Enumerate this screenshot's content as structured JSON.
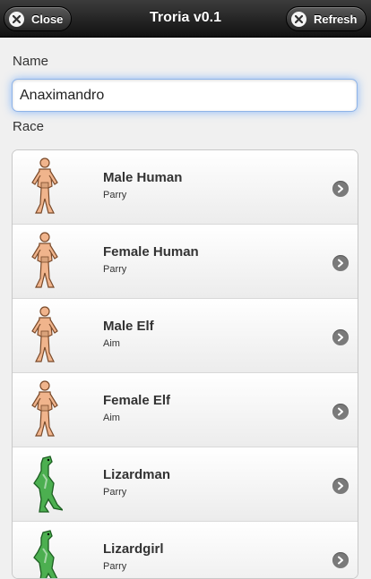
{
  "header": {
    "title": "Troria v0.1",
    "close_label": "Close",
    "refresh_label": "Refresh"
  },
  "form": {
    "name_label": "Name",
    "name_value": "Anaximandro",
    "race_label": "Race"
  },
  "races": [
    {
      "name": "Male Human",
      "skill": "Parry",
      "sprite": "human-male-icon"
    },
    {
      "name": "Female Human",
      "skill": "Parry",
      "sprite": "human-female-icon"
    },
    {
      "name": "Male Elf",
      "skill": "Aim",
      "sprite": "elf-male-icon"
    },
    {
      "name": "Female Elf",
      "skill": "Aim",
      "sprite": "elf-female-icon"
    },
    {
      "name": "Lizardman",
      "skill": "Parry",
      "sprite": "lizard-male-icon"
    },
    {
      "name": "Lizardgirl",
      "skill": "Parry",
      "sprite": "lizard-female-icon"
    }
  ],
  "colors": {
    "human_skin": "#f0b48c",
    "lizard_skin": "#4caf50",
    "header_dark": "#111111",
    "input_focus": "#8fb4e8"
  }
}
